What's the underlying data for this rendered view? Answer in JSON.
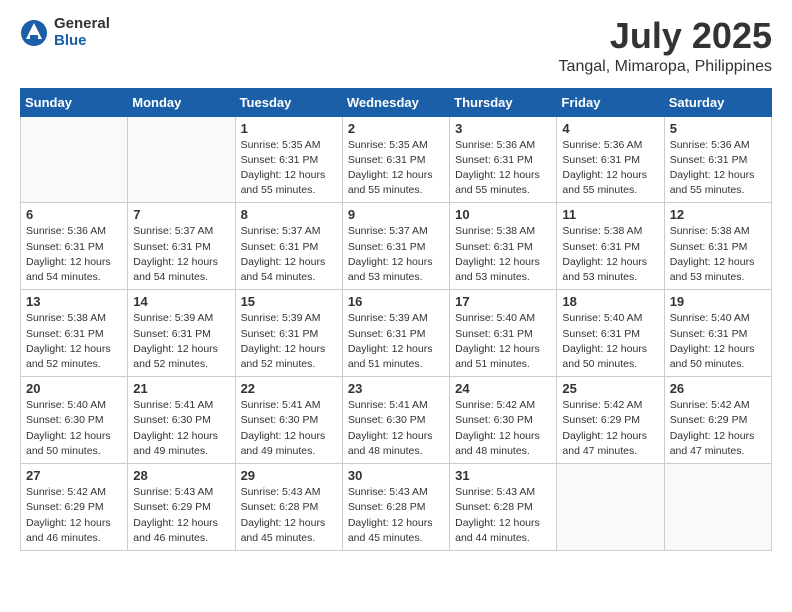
{
  "logo": {
    "general": "General",
    "blue": "Blue"
  },
  "title": "July 2025",
  "location": "Tangal, Mimaropa, Philippines",
  "days_of_week": [
    "Sunday",
    "Monday",
    "Tuesday",
    "Wednesday",
    "Thursday",
    "Friday",
    "Saturday"
  ],
  "weeks": [
    [
      {
        "day": "",
        "sunrise": "",
        "sunset": "",
        "daylight": ""
      },
      {
        "day": "",
        "sunrise": "",
        "sunset": "",
        "daylight": ""
      },
      {
        "day": "1",
        "sunrise": "Sunrise: 5:35 AM",
        "sunset": "Sunset: 6:31 PM",
        "daylight": "Daylight: 12 hours and 55 minutes."
      },
      {
        "day": "2",
        "sunrise": "Sunrise: 5:35 AM",
        "sunset": "Sunset: 6:31 PM",
        "daylight": "Daylight: 12 hours and 55 minutes."
      },
      {
        "day": "3",
        "sunrise": "Sunrise: 5:36 AM",
        "sunset": "Sunset: 6:31 PM",
        "daylight": "Daylight: 12 hours and 55 minutes."
      },
      {
        "day": "4",
        "sunrise": "Sunrise: 5:36 AM",
        "sunset": "Sunset: 6:31 PM",
        "daylight": "Daylight: 12 hours and 55 minutes."
      },
      {
        "day": "5",
        "sunrise": "Sunrise: 5:36 AM",
        "sunset": "Sunset: 6:31 PM",
        "daylight": "Daylight: 12 hours and 55 minutes."
      }
    ],
    [
      {
        "day": "6",
        "sunrise": "Sunrise: 5:36 AM",
        "sunset": "Sunset: 6:31 PM",
        "daylight": "Daylight: 12 hours and 54 minutes."
      },
      {
        "day": "7",
        "sunrise": "Sunrise: 5:37 AM",
        "sunset": "Sunset: 6:31 PM",
        "daylight": "Daylight: 12 hours and 54 minutes."
      },
      {
        "day": "8",
        "sunrise": "Sunrise: 5:37 AM",
        "sunset": "Sunset: 6:31 PM",
        "daylight": "Daylight: 12 hours and 54 minutes."
      },
      {
        "day": "9",
        "sunrise": "Sunrise: 5:37 AM",
        "sunset": "Sunset: 6:31 PM",
        "daylight": "Daylight: 12 hours and 53 minutes."
      },
      {
        "day": "10",
        "sunrise": "Sunrise: 5:38 AM",
        "sunset": "Sunset: 6:31 PM",
        "daylight": "Daylight: 12 hours and 53 minutes."
      },
      {
        "day": "11",
        "sunrise": "Sunrise: 5:38 AM",
        "sunset": "Sunset: 6:31 PM",
        "daylight": "Daylight: 12 hours and 53 minutes."
      },
      {
        "day": "12",
        "sunrise": "Sunrise: 5:38 AM",
        "sunset": "Sunset: 6:31 PM",
        "daylight": "Daylight: 12 hours and 53 minutes."
      }
    ],
    [
      {
        "day": "13",
        "sunrise": "Sunrise: 5:38 AM",
        "sunset": "Sunset: 6:31 PM",
        "daylight": "Daylight: 12 hours and 52 minutes."
      },
      {
        "day": "14",
        "sunrise": "Sunrise: 5:39 AM",
        "sunset": "Sunset: 6:31 PM",
        "daylight": "Daylight: 12 hours and 52 minutes."
      },
      {
        "day": "15",
        "sunrise": "Sunrise: 5:39 AM",
        "sunset": "Sunset: 6:31 PM",
        "daylight": "Daylight: 12 hours and 52 minutes."
      },
      {
        "day": "16",
        "sunrise": "Sunrise: 5:39 AM",
        "sunset": "Sunset: 6:31 PM",
        "daylight": "Daylight: 12 hours and 51 minutes."
      },
      {
        "day": "17",
        "sunrise": "Sunrise: 5:40 AM",
        "sunset": "Sunset: 6:31 PM",
        "daylight": "Daylight: 12 hours and 51 minutes."
      },
      {
        "day": "18",
        "sunrise": "Sunrise: 5:40 AM",
        "sunset": "Sunset: 6:31 PM",
        "daylight": "Daylight: 12 hours and 50 minutes."
      },
      {
        "day": "19",
        "sunrise": "Sunrise: 5:40 AM",
        "sunset": "Sunset: 6:31 PM",
        "daylight": "Daylight: 12 hours and 50 minutes."
      }
    ],
    [
      {
        "day": "20",
        "sunrise": "Sunrise: 5:40 AM",
        "sunset": "Sunset: 6:30 PM",
        "daylight": "Daylight: 12 hours and 50 minutes."
      },
      {
        "day": "21",
        "sunrise": "Sunrise: 5:41 AM",
        "sunset": "Sunset: 6:30 PM",
        "daylight": "Daylight: 12 hours and 49 minutes."
      },
      {
        "day": "22",
        "sunrise": "Sunrise: 5:41 AM",
        "sunset": "Sunset: 6:30 PM",
        "daylight": "Daylight: 12 hours and 49 minutes."
      },
      {
        "day": "23",
        "sunrise": "Sunrise: 5:41 AM",
        "sunset": "Sunset: 6:30 PM",
        "daylight": "Daylight: 12 hours and 48 minutes."
      },
      {
        "day": "24",
        "sunrise": "Sunrise: 5:42 AM",
        "sunset": "Sunset: 6:30 PM",
        "daylight": "Daylight: 12 hours and 48 minutes."
      },
      {
        "day": "25",
        "sunrise": "Sunrise: 5:42 AM",
        "sunset": "Sunset: 6:29 PM",
        "daylight": "Daylight: 12 hours and 47 minutes."
      },
      {
        "day": "26",
        "sunrise": "Sunrise: 5:42 AM",
        "sunset": "Sunset: 6:29 PM",
        "daylight": "Daylight: 12 hours and 47 minutes."
      }
    ],
    [
      {
        "day": "27",
        "sunrise": "Sunrise: 5:42 AM",
        "sunset": "Sunset: 6:29 PM",
        "daylight": "Daylight: 12 hours and 46 minutes."
      },
      {
        "day": "28",
        "sunrise": "Sunrise: 5:43 AM",
        "sunset": "Sunset: 6:29 PM",
        "daylight": "Daylight: 12 hours and 46 minutes."
      },
      {
        "day": "29",
        "sunrise": "Sunrise: 5:43 AM",
        "sunset": "Sunset: 6:28 PM",
        "daylight": "Daylight: 12 hours and 45 minutes."
      },
      {
        "day": "30",
        "sunrise": "Sunrise: 5:43 AM",
        "sunset": "Sunset: 6:28 PM",
        "daylight": "Daylight: 12 hours and 45 minutes."
      },
      {
        "day": "31",
        "sunrise": "Sunrise: 5:43 AM",
        "sunset": "Sunset: 6:28 PM",
        "daylight": "Daylight: 12 hours and 44 minutes."
      },
      {
        "day": "",
        "sunrise": "",
        "sunset": "",
        "daylight": ""
      },
      {
        "day": "",
        "sunrise": "",
        "sunset": "",
        "daylight": ""
      }
    ]
  ]
}
